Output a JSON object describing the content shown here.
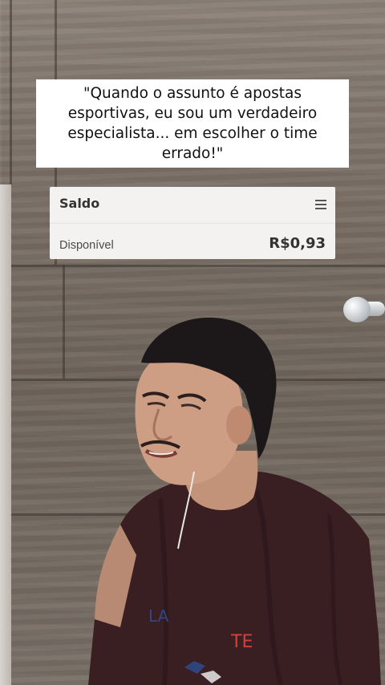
{
  "caption": {
    "text": "\"Quando o assunto é apostas esportivas, eu sou um verdadeiro especialista... em escolher o time errado!\""
  },
  "balance_card": {
    "title": "Saldo",
    "available_label": "Disponível",
    "available_value": "R$0,93",
    "menu_icon": "hamburger-menu-icon"
  },
  "shirt_print": {
    "letters_left": "LA",
    "letters_right": "TE"
  },
  "colors": {
    "caption_bg": "#ffffff",
    "card_bg": "#f3f2f1",
    "wall": "#7b7067",
    "shirt": "#3a1f22"
  }
}
